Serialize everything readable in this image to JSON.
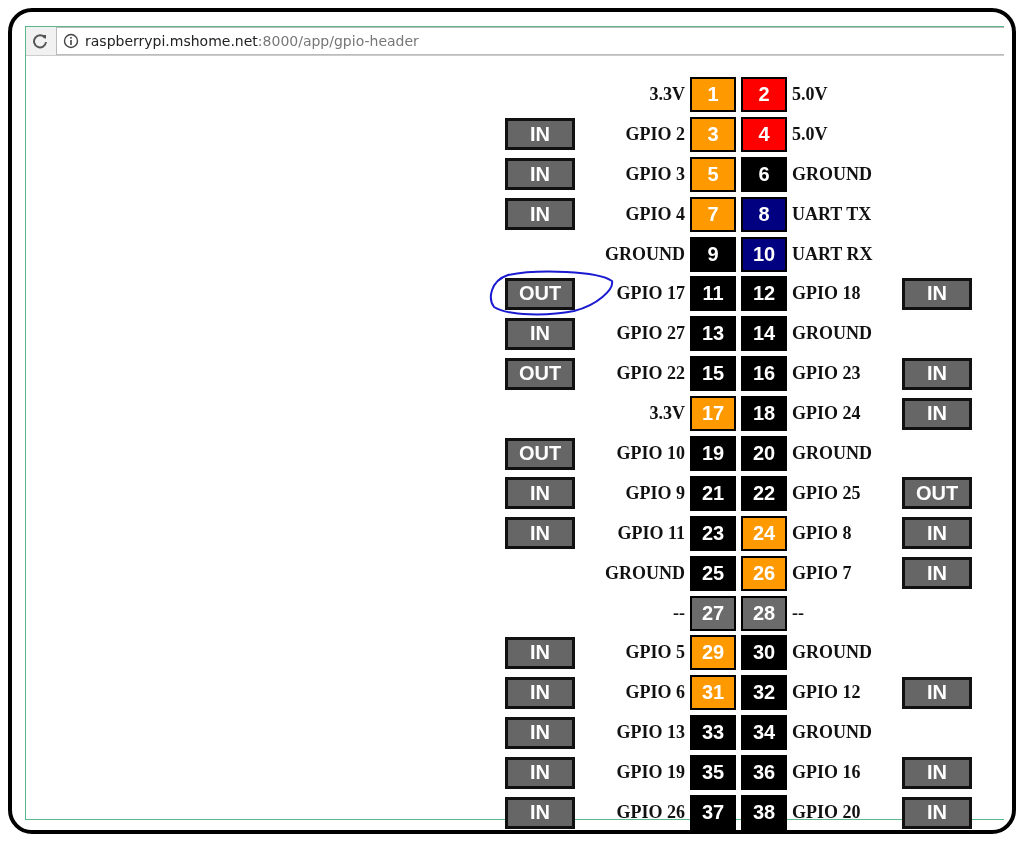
{
  "address_bar": {
    "url_host": "raspberrypi.mshome.net",
    "url_path": ":8000/app/gpio-header"
  },
  "header_rows": [
    {
      "left": {
        "label": "3.3V",
        "pin": "1",
        "color": "#ff9900"
      },
      "right": {
        "label": "5.0V",
        "pin": "2",
        "color": "#ff0000"
      }
    },
    {
      "left": {
        "mode": "IN",
        "circled": false,
        "label": "GPIO 2",
        "pin": "3",
        "color": "#ff9900"
      },
      "right": {
        "label": "5.0V",
        "pin": "4",
        "color": "#ff0000"
      }
    },
    {
      "left": {
        "mode": "IN",
        "circled": false,
        "label": "GPIO 3",
        "pin": "5",
        "color": "#ff9900"
      },
      "right": {
        "label": "GROUND",
        "pin": "6",
        "color": "#000000"
      }
    },
    {
      "left": {
        "mode": "IN",
        "circled": false,
        "label": "GPIO 4",
        "pin": "7",
        "color": "#ff9900"
      },
      "right": {
        "label": "UART TX",
        "pin": "8",
        "color": "#000080"
      }
    },
    {
      "left": {
        "label": "GROUND",
        "pin": "9",
        "color": "#000000"
      },
      "right": {
        "label": "UART RX",
        "pin": "10",
        "color": "#000080"
      }
    },
    {
      "left": {
        "mode": "OUT",
        "circled": true,
        "label": "GPIO 17",
        "pin": "11",
        "color": "#000000"
      },
      "right": {
        "mode": "IN",
        "label": "GPIO 18",
        "pin": "12",
        "color": "#000000"
      }
    },
    {
      "left": {
        "mode": "IN",
        "circled": false,
        "label": "GPIO 27",
        "pin": "13",
        "color": "#000000"
      },
      "right": {
        "label": "GROUND",
        "pin": "14",
        "color": "#000000"
      }
    },
    {
      "left": {
        "mode": "OUT",
        "circled": false,
        "label": "GPIO 22",
        "pin": "15",
        "color": "#000000"
      },
      "right": {
        "mode": "IN",
        "label": "GPIO 23",
        "pin": "16",
        "color": "#000000"
      }
    },
    {
      "left": {
        "label": "3.3V",
        "pin": "17",
        "color": "#ff9900"
      },
      "right": {
        "mode": "IN",
        "label": "GPIO 24",
        "pin": "18",
        "color": "#000000"
      }
    },
    {
      "left": {
        "mode": "OUT",
        "circled": false,
        "label": "GPIO 10",
        "pin": "19",
        "color": "#000000"
      },
      "right": {
        "label": "GROUND",
        "pin": "20",
        "color": "#000000"
      }
    },
    {
      "left": {
        "mode": "IN",
        "circled": false,
        "label": "GPIO 9",
        "pin": "21",
        "color": "#000000"
      },
      "right": {
        "mode": "OUT",
        "label": "GPIO 25",
        "pin": "22",
        "color": "#000000"
      }
    },
    {
      "left": {
        "mode": "IN",
        "circled": false,
        "label": "GPIO 11",
        "pin": "23",
        "color": "#000000"
      },
      "right": {
        "mode": "IN",
        "label": "GPIO 8",
        "pin": "24",
        "color": "#ff9900"
      }
    },
    {
      "left": {
        "label": "GROUND",
        "pin": "25",
        "color": "#000000"
      },
      "right": {
        "mode": "IN",
        "label": "GPIO 7",
        "pin": "26",
        "color": "#ff9900"
      }
    },
    {
      "left": {
        "label": "--",
        "pin": "27",
        "color": "#6b6b6b"
      },
      "right": {
        "label": "--",
        "pin": "28",
        "color": "#6b6b6b"
      }
    },
    {
      "left": {
        "mode": "IN",
        "circled": false,
        "label": "GPIO 5",
        "pin": "29",
        "color": "#ff9900"
      },
      "right": {
        "label": "GROUND",
        "pin": "30",
        "color": "#000000"
      }
    },
    {
      "left": {
        "mode": "IN",
        "circled": false,
        "label": "GPIO 6",
        "pin": "31",
        "color": "#ff9900"
      },
      "right": {
        "mode": "IN",
        "label": "GPIO 12",
        "pin": "32",
        "color": "#000000"
      }
    },
    {
      "left": {
        "mode": "IN",
        "circled": false,
        "label": "GPIO 13",
        "pin": "33",
        "color": "#000000"
      },
      "right": {
        "label": "GROUND",
        "pin": "34",
        "color": "#000000"
      }
    },
    {
      "left": {
        "mode": "IN",
        "circled": false,
        "label": "GPIO 19",
        "pin": "35",
        "color": "#000000"
      },
      "right": {
        "mode": "IN",
        "label": "GPIO 16",
        "pin": "36",
        "color": "#000000"
      }
    },
    {
      "left": {
        "mode": "IN",
        "circled": false,
        "label": "GPIO 26",
        "pin": "37",
        "color": "#000000"
      },
      "right": {
        "mode": "IN",
        "label": "GPIO 20",
        "pin": "38",
        "color": "#000000"
      }
    }
  ]
}
